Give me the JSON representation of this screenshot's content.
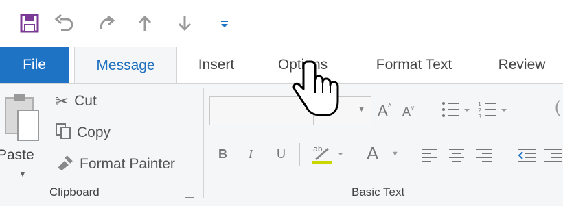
{
  "quick_access": {
    "icons": [
      "save-icon",
      "undo-icon",
      "redo-icon",
      "up-arrow-icon",
      "down-arrow-icon",
      "customize-qat-icon"
    ]
  },
  "tabs": {
    "file": "File",
    "message": "Message",
    "insert": "Insert",
    "options": "Options",
    "format_text": "Format Text",
    "review": "Review"
  },
  "clipboard": {
    "paste": "Paste",
    "cut": "Cut",
    "copy": "Copy",
    "format_painter": "Format Painter",
    "group_label": "Clipboard"
  },
  "basic_text": {
    "group_label": "Basic Text",
    "bold": "B",
    "italic": "I",
    "underline": "U",
    "font_color": "A",
    "grow_font": "A",
    "shrink_font": "A"
  },
  "colors": {
    "file_tab": "#1f73c4",
    "active_tab_text": "#1f6fbf",
    "save_icon": "#7b3a96",
    "highlight": "#c9d600"
  }
}
